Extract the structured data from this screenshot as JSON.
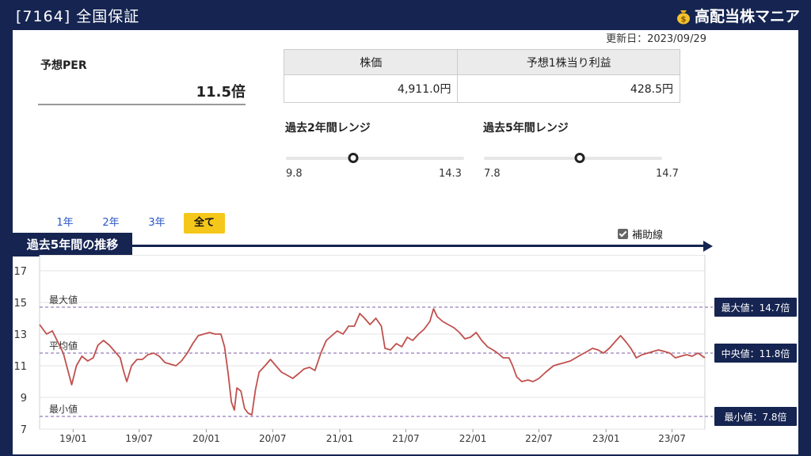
{
  "header": {
    "title": "[7164] 全国保証",
    "brand": "高配当株マニア"
  },
  "updated": "更新日：2023/09/29",
  "per": {
    "label": "予想PER",
    "value": "11.5倍"
  },
  "metrics": {
    "price_label": "株価",
    "price_value": "4,911.0円",
    "eps_label": "予想1株当り利益",
    "eps_value": "428.5円"
  },
  "ranges": {
    "y2": {
      "title": "過去2年間レンジ",
      "min": "9.8",
      "max": "14.3",
      "current": 11.5
    },
    "y5": {
      "title": "過去5年間レンジ",
      "min": "7.8",
      "max": "14.7",
      "current": 11.5
    }
  },
  "tabs": [
    "1年",
    "2年",
    "3年",
    "全て"
  ],
  "active_tab": "全て",
  "section_title": "過去5年間の推移",
  "aux_label": "補助線",
  "chart_data": {
    "type": "line",
    "ylim": [
      7,
      18
    ],
    "yticks": [
      7,
      9,
      11,
      13,
      15,
      17
    ],
    "x_range": [
      "2018-10-01",
      "2023-09-29"
    ],
    "xticks": [
      {
        "date": "2019-01-01",
        "label": "19/01"
      },
      {
        "date": "2019-07-01",
        "label": "19/07"
      },
      {
        "date": "2020-01-01",
        "label": "20/01"
      },
      {
        "date": "2020-07-01",
        "label": "20/07"
      },
      {
        "date": "2021-01-01",
        "label": "21/01"
      },
      {
        "date": "2021-07-01",
        "label": "21/07"
      },
      {
        "date": "2022-01-01",
        "label": "22/01"
      },
      {
        "date": "2022-07-01",
        "label": "22/07"
      },
      {
        "date": "2023-01-01",
        "label": "23/01"
      },
      {
        "date": "2023-07-01",
        "label": "23/07"
      }
    ],
    "series": [
      {
        "color": "#c0504d",
        "points": [
          [
            "2018-10-01",
            13.6
          ],
          [
            "2018-10-20",
            13.0
          ],
          [
            "2018-11-05",
            13.2
          ],
          [
            "2018-11-20",
            12.5
          ],
          [
            "2018-12-05",
            11.8
          ],
          [
            "2018-12-20",
            10.5
          ],
          [
            "2018-12-28",
            9.8
          ],
          [
            "2019-01-10",
            11.0
          ],
          [
            "2019-01-25",
            11.6
          ],
          [
            "2019-02-10",
            11.3
          ],
          [
            "2019-02-25",
            11.5
          ],
          [
            "2019-03-10",
            12.3
          ],
          [
            "2019-03-25",
            12.6
          ],
          [
            "2019-04-10",
            12.3
          ],
          [
            "2019-04-25",
            11.9
          ],
          [
            "2019-05-10",
            11.5
          ],
          [
            "2019-05-20",
            10.6
          ],
          [
            "2019-05-28",
            10.0
          ],
          [
            "2019-06-10",
            11.0
          ],
          [
            "2019-06-25",
            11.4
          ],
          [
            "2019-07-10",
            11.4
          ],
          [
            "2019-07-25",
            11.7
          ],
          [
            "2019-08-10",
            11.8
          ],
          [
            "2019-08-25",
            11.6
          ],
          [
            "2019-09-10",
            11.2
          ],
          [
            "2019-09-25",
            11.1
          ],
          [
            "2019-10-10",
            11.0
          ],
          [
            "2019-10-25",
            11.3
          ],
          [
            "2019-11-10",
            11.8
          ],
          [
            "2019-11-25",
            12.4
          ],
          [
            "2019-12-10",
            12.9
          ],
          [
            "2019-12-25",
            13.0
          ],
          [
            "2020-01-10",
            13.1
          ],
          [
            "2020-01-25",
            13.0
          ],
          [
            "2020-02-10",
            13.0
          ],
          [
            "2020-02-20",
            12.2
          ],
          [
            "2020-03-01",
            10.5
          ],
          [
            "2020-03-10",
            8.7
          ],
          [
            "2020-03-18",
            8.2
          ],
          [
            "2020-03-25",
            9.6
          ],
          [
            "2020-04-05",
            9.4
          ],
          [
            "2020-04-15",
            8.3
          ],
          [
            "2020-04-25",
            8.0
          ],
          [
            "2020-05-05",
            7.9
          ],
          [
            "2020-05-15",
            9.5
          ],
          [
            "2020-05-25",
            10.6
          ],
          [
            "2020-06-10",
            11.0
          ],
          [
            "2020-06-25",
            11.4
          ],
          [
            "2020-07-10",
            11.0
          ],
          [
            "2020-07-25",
            10.6
          ],
          [
            "2020-08-10",
            10.4
          ],
          [
            "2020-08-25",
            10.2
          ],
          [
            "2020-09-10",
            10.5
          ],
          [
            "2020-09-25",
            10.8
          ],
          [
            "2020-10-10",
            10.9
          ],
          [
            "2020-10-25",
            10.7
          ],
          [
            "2020-11-10",
            11.8
          ],
          [
            "2020-11-25",
            12.6
          ],
          [
            "2020-12-10",
            12.9
          ],
          [
            "2020-12-25",
            13.2
          ],
          [
            "2021-01-10",
            13.0
          ],
          [
            "2021-01-25",
            13.5
          ],
          [
            "2021-02-10",
            13.5
          ],
          [
            "2021-02-25",
            14.3
          ],
          [
            "2021-03-10",
            14.0
          ],
          [
            "2021-03-25",
            13.6
          ],
          [
            "2021-04-10",
            14.0
          ],
          [
            "2021-04-25",
            13.5
          ],
          [
            "2021-05-05",
            12.1
          ],
          [
            "2021-05-20",
            12.0
          ],
          [
            "2021-06-05",
            12.4
          ],
          [
            "2021-06-20",
            12.2
          ],
          [
            "2021-07-05",
            12.8
          ],
          [
            "2021-07-20",
            12.6
          ],
          [
            "2021-08-05",
            13.0
          ],
          [
            "2021-08-20",
            13.3
          ],
          [
            "2021-09-05",
            13.8
          ],
          [
            "2021-09-15",
            14.6
          ],
          [
            "2021-09-25",
            14.1
          ],
          [
            "2021-10-10",
            13.8
          ],
          [
            "2021-10-25",
            13.6
          ],
          [
            "2021-11-10",
            13.4
          ],
          [
            "2021-11-25",
            13.1
          ],
          [
            "2021-12-10",
            12.7
          ],
          [
            "2021-12-25",
            12.8
          ],
          [
            "2022-01-10",
            13.1
          ],
          [
            "2022-01-25",
            12.6
          ],
          [
            "2022-02-10",
            12.2
          ],
          [
            "2022-02-25",
            12.0
          ],
          [
            "2022-03-10",
            11.8
          ],
          [
            "2022-03-25",
            11.5
          ],
          [
            "2022-04-10",
            11.5
          ],
          [
            "2022-04-20",
            11.0
          ],
          [
            "2022-05-01",
            10.3
          ],
          [
            "2022-05-15",
            10.0
          ],
          [
            "2022-06-01",
            10.1
          ],
          [
            "2022-06-15",
            10.0
          ],
          [
            "2022-07-01",
            10.2
          ],
          [
            "2022-07-20",
            10.6
          ],
          [
            "2022-08-10",
            11.0
          ],
          [
            "2022-08-25",
            11.1
          ],
          [
            "2022-09-10",
            11.2
          ],
          [
            "2022-09-25",
            11.3
          ],
          [
            "2022-10-10",
            11.5
          ],
          [
            "2022-10-25",
            11.7
          ],
          [
            "2022-11-10",
            11.9
          ],
          [
            "2022-11-25",
            12.1
          ],
          [
            "2022-12-10",
            12.0
          ],
          [
            "2022-12-25",
            11.8
          ],
          [
            "2023-01-10",
            12.1
          ],
          [
            "2023-01-25",
            12.5
          ],
          [
            "2023-02-10",
            12.9
          ],
          [
            "2023-02-25",
            12.5
          ],
          [
            "2023-03-10",
            12.1
          ],
          [
            "2023-03-25",
            11.5
          ],
          [
            "2023-04-10",
            11.7
          ],
          [
            "2023-04-25",
            11.8
          ],
          [
            "2023-05-10",
            11.9
          ],
          [
            "2023-05-25",
            12.0
          ],
          [
            "2023-06-10",
            11.9
          ],
          [
            "2023-06-25",
            11.8
          ],
          [
            "2023-07-10",
            11.5
          ],
          [
            "2023-07-25",
            11.6
          ],
          [
            "2023-08-10",
            11.7
          ],
          [
            "2023-08-25",
            11.6
          ],
          [
            "2023-09-10",
            11.8
          ],
          [
            "2023-09-29",
            11.5
          ]
        ]
      }
    ],
    "reference_lines": [
      {
        "key": "max",
        "value": 14.7,
        "label": "最大値",
        "badge": "最大値：14.7倍"
      },
      {
        "key": "median",
        "value": 11.8,
        "label": "平均値",
        "badge": "中央値：11.8倍"
      },
      {
        "key": "min",
        "value": 7.8,
        "label": "最小値",
        "badge": "最小値：7.8倍"
      }
    ],
    "ref_line_color": "#7b5ea7"
  }
}
